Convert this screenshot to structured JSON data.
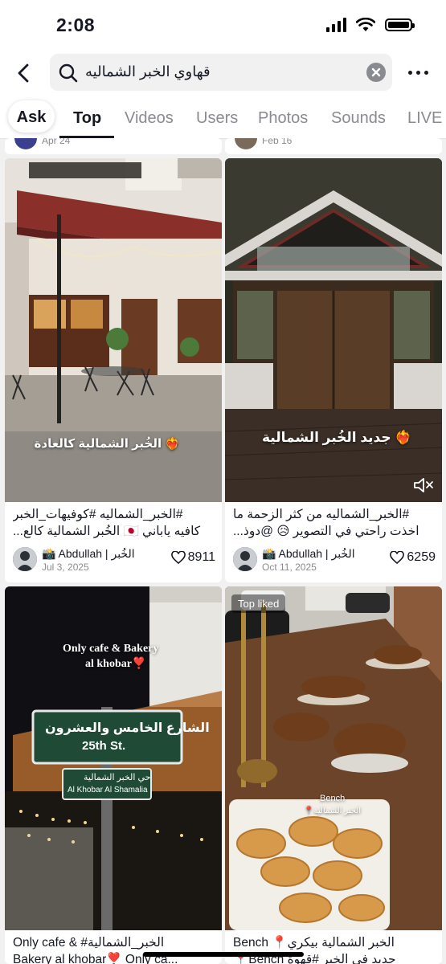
{
  "status_bar": {
    "time": "2:08"
  },
  "search": {
    "query": "قهاوي الخبر الشماليه"
  },
  "tabs": [
    {
      "label": "Ask"
    },
    {
      "label": "Top"
    },
    {
      "label": "Videos"
    },
    {
      "label": "Users"
    },
    {
      "label": "Photos"
    },
    {
      "label": "Sounds"
    },
    {
      "label": "LIVE"
    }
  ],
  "active_tab": "Top",
  "partial_top_row": [
    {
      "date": "Apr 24"
    },
    {
      "date": "Feb 16"
    }
  ],
  "posts": [
    {
      "overlay": "الخُبر الشمالية كالعادة ❤️‍🔥",
      "caption_line1": "#الخبر_الشماليه #كوفيهات_الخبر",
      "caption_line2": "كافيه ياباني 🇯🇵 الخُبر الشمالية كالع...",
      "author": "📸 Abdullah | الخُبر",
      "date": "Jul 3, 2025",
      "likes": "8911"
    },
    {
      "overlay": "جديد الخُبر الشمالية ❤️‍🔥",
      "caption_line1": "#الخبر_الشماليه من كثر الزحمة ما",
      "caption_line2": "اخذت راحتي في التصوير 😥 @دوذ...",
      "author": "📸 Abdullah | الخُبر",
      "date": "Oct 11, 2025",
      "likes": "6259"
    },
    {
      "overlay_line1": "Only cafe & Bakery",
      "overlay_line2": "al khobar❣️",
      "sign_line1": "الشارع الخامس والعشرون",
      "sign_line2": "25th St.",
      "sign2_line1": "حي الخبر الشمالية",
      "sign2_line2": "Al Khobar Al Shamalia",
      "caption_line1": "Only cafe & #الخبر_الشمالية",
      "caption_line2": "Bakery al khobar❣️ Only ca..."
    },
    {
      "badge": "Top liked",
      "overlay_line1": "Bench",
      "overlay_line2": "📍الخبر الشمالية",
      "caption_line1": "Bench 📍الخبر الشمالية بيكري",
      "caption_line2": "📍Bench جديد في الخبر #قهوة"
    }
  ]
}
